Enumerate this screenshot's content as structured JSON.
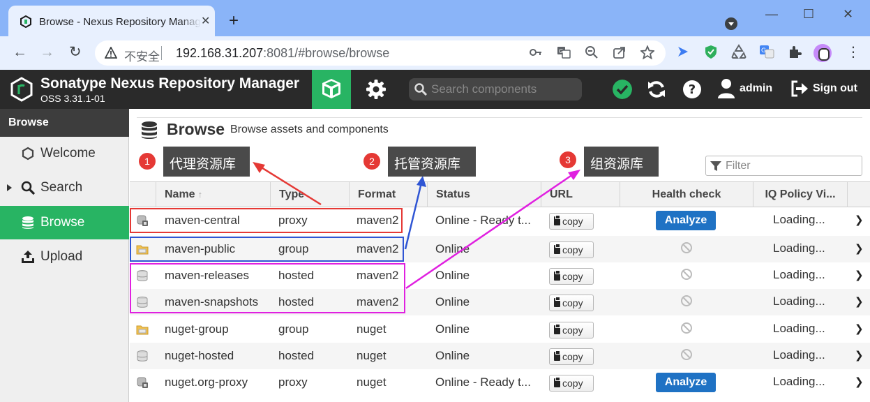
{
  "browser": {
    "tab_title": "Browse - Nexus Repository Manager",
    "tab_close": "✕",
    "new_tab": "+",
    "insecure_label": "不安全",
    "url_host": "192.168.31.207",
    "url_rest": ":8081/#browse/browse",
    "window_min": "—",
    "window_max": "☐",
    "window_close": "✕",
    "nav_back": "←",
    "nav_forward": "→",
    "nav_reload": "↻"
  },
  "header": {
    "app_title": "Sonatype Nexus Repository Manager",
    "version": "OSS 3.31.1-01",
    "search_placeholder": "Search components",
    "user": "admin",
    "signout": "Sign out"
  },
  "sidebar": {
    "heading": "Browse",
    "items": [
      {
        "label": "Welcome",
        "icon": "hexagon-icon"
      },
      {
        "label": "Search",
        "icon": "search-icon"
      },
      {
        "label": "Browse",
        "icon": "database-icon"
      },
      {
        "label": "Upload",
        "icon": "upload-icon"
      }
    ]
  },
  "page": {
    "title": "Browse",
    "subtitle": "Browse assets and components",
    "filter_placeholder": "Filter"
  },
  "grid": {
    "columns": [
      "Name",
      "Type",
      "Format",
      "Status",
      "URL",
      "Health check",
      "IQ Policy Vi..."
    ],
    "sort_indicator": "↑",
    "copy_label": "copy",
    "analyze_label": "Analyze",
    "rows": [
      {
        "name": "maven-central",
        "type": "proxy",
        "format": "maven2",
        "status": "Online - Ready t...",
        "health": "analyze",
        "iq": "Loading...",
        "icon": "proxy-icon"
      },
      {
        "name": "maven-public",
        "type": "group",
        "format": "maven2",
        "status": "Online",
        "health": "disabled",
        "iq": "Loading...",
        "icon": "group-folder-icon"
      },
      {
        "name": "maven-releases",
        "type": "hosted",
        "format": "maven2",
        "status": "Online",
        "health": "disabled",
        "iq": "Loading...",
        "icon": "hosted-db-icon"
      },
      {
        "name": "maven-snapshots",
        "type": "hosted",
        "format": "maven2",
        "status": "Online",
        "health": "disabled",
        "iq": "Loading...",
        "icon": "hosted-db-icon"
      },
      {
        "name": "nuget-group",
        "type": "group",
        "format": "nuget",
        "status": "Online",
        "health": "disabled",
        "iq": "Loading...",
        "icon": "group-folder-icon"
      },
      {
        "name": "nuget-hosted",
        "type": "hosted",
        "format": "nuget",
        "status": "Online",
        "health": "disabled",
        "iq": "Loading...",
        "icon": "hosted-db-icon"
      },
      {
        "name": "nuget.org-proxy",
        "type": "proxy",
        "format": "nuget",
        "status": "Online - Ready t...",
        "health": "analyze",
        "iq": "Loading...",
        "icon": "proxy-icon"
      }
    ]
  },
  "annotations": [
    {
      "num": "1",
      "label": "代理资源库",
      "color": "#e53935"
    },
    {
      "num": "2",
      "label": "托管资源库",
      "color": "#2f55d4"
    },
    {
      "num": "3",
      "label": "组资源库",
      "color": "#e020e0"
    }
  ],
  "colors": {
    "nexus_green": "#28b463",
    "header_dark": "#2a2a2a",
    "analyze_blue": "#1f72c4",
    "chrome_blue": "#8ab4f8"
  }
}
